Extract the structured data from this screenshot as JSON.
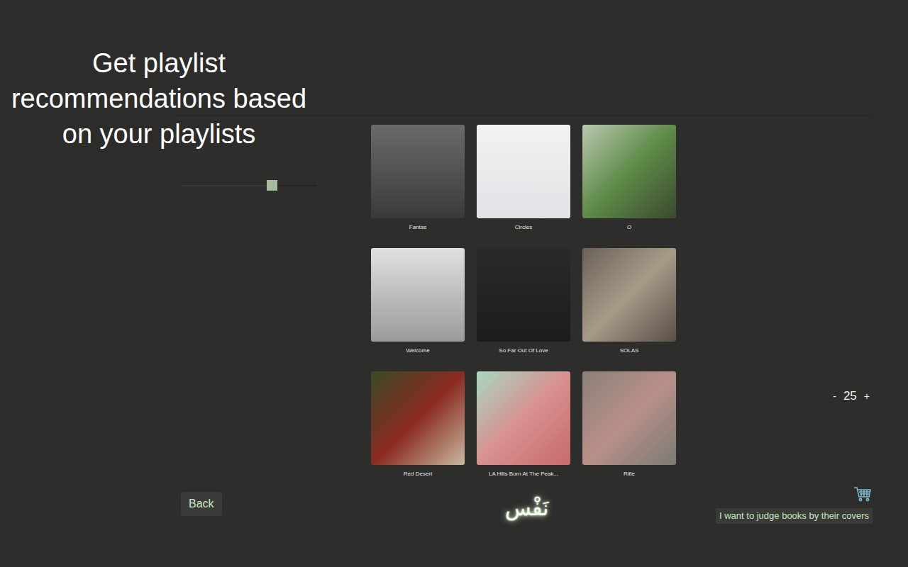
{
  "heading": "Get playlist recommendations based on your playlists",
  "slider": {
    "level": 0.67
  },
  "albums": [
    {
      "title": "Fantas"
    },
    {
      "title": "Circles"
    },
    {
      "title": "O"
    },
    {
      "title": "Welcome"
    },
    {
      "title": "So Far Out Of Love"
    },
    {
      "title": "SOLAS"
    },
    {
      "title": "Red Desert"
    },
    {
      "title": "LA Hills Burn At The Peak..."
    },
    {
      "title": "Rifle"
    }
  ],
  "count": {
    "minus": "-",
    "value": "25",
    "plus": "+"
  },
  "back_button": "Back",
  "logo": "نَفْس",
  "cover_toggle": "I want to judge books by their covers"
}
